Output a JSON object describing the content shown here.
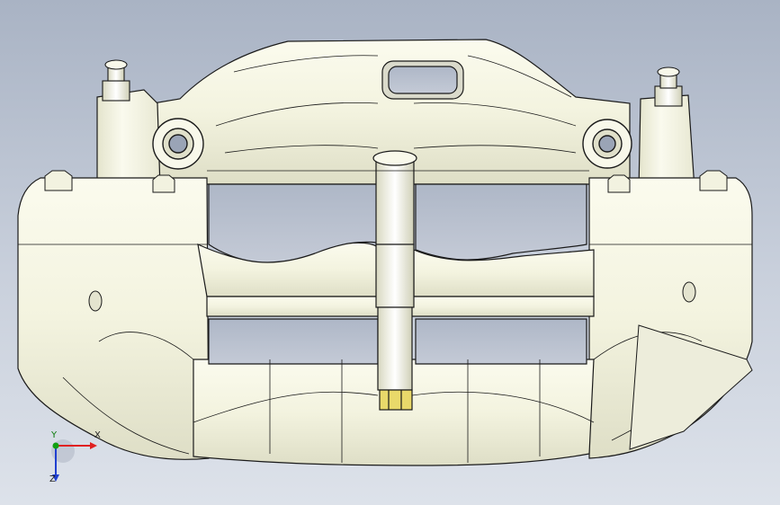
{
  "viewport": {
    "model_name": "brake-caliper",
    "background_top": "#a9b3c4",
    "background_bottom": "#dde2ea",
    "body_color": "#f6f6e6",
    "shade_color": "#d9d9c3",
    "edge_color": "#1a1a1a",
    "highlight_color": "#e9d96a"
  },
  "triad": {
    "x_label": "X",
    "y_label": "Y",
    "z_label": "Z",
    "x_color": "#e02020",
    "y_color": "#10a010",
    "z_color": "#2040d0"
  }
}
